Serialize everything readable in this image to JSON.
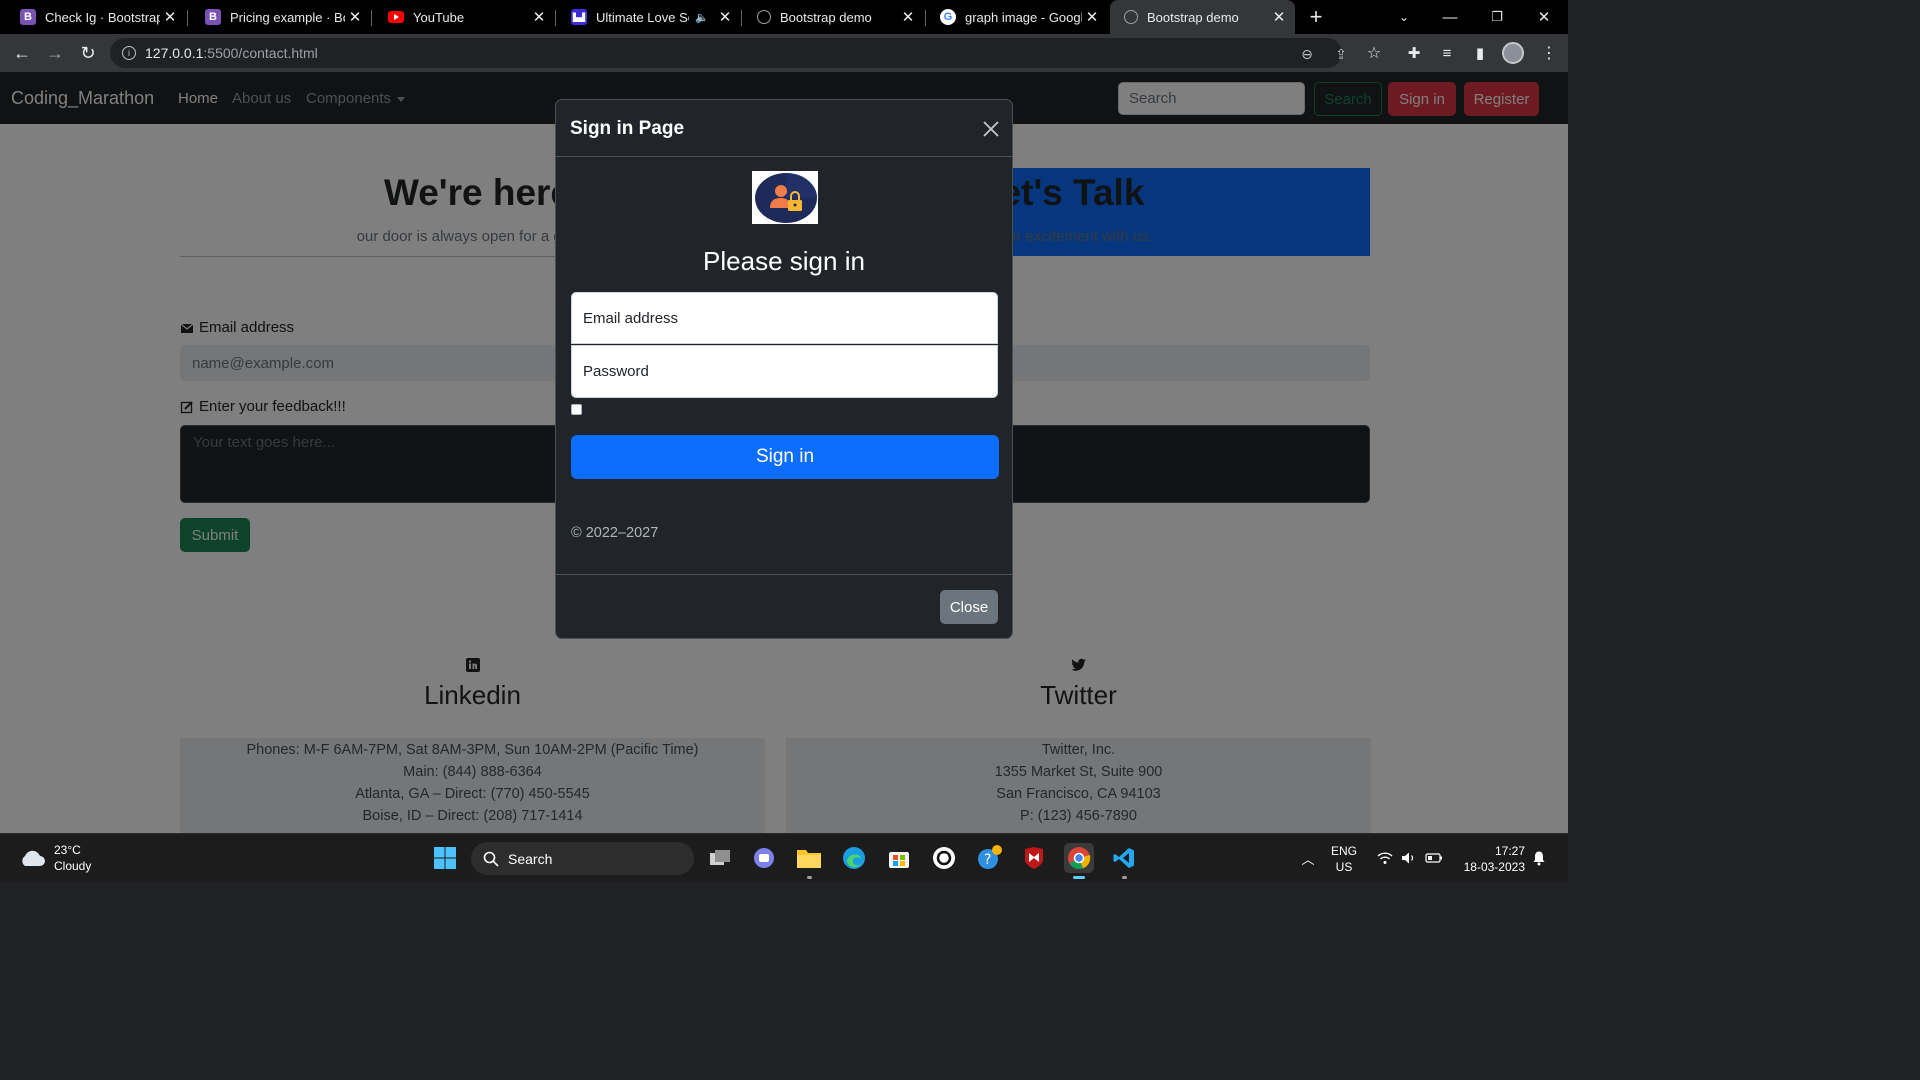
{
  "browser": {
    "tabs": [
      {
        "title": "Check Ig · Bootstrap Ic",
        "favicon": "bootstrap-icon",
        "color": "#7952b3"
      },
      {
        "title": "Pricing example · Boo",
        "favicon": "bootstrap-icon",
        "color": "#7952b3"
      },
      {
        "title": "YouTube",
        "favicon": "youtube-icon",
        "color": "#ff0000"
      },
      {
        "title": "Ultimate Love Son",
        "favicon": "music-icon",
        "color": "#3d2cd8",
        "audio": true
      },
      {
        "title": "Bootstrap demo",
        "favicon": "globe-icon",
        "color": "#9aa0a6"
      },
      {
        "title": "graph image - Googl",
        "favicon": "google-icon",
        "color": "#4285f4"
      },
      {
        "title": "Bootstrap demo",
        "favicon": "globe-icon",
        "color": "#9aa0a6",
        "active": true
      }
    ],
    "url_host": "127.0.0.1",
    "url_path": ":5500/contact.html"
  },
  "navbar": {
    "brand": "Coding_Marathon",
    "links": [
      "Home",
      "About us",
      "Components"
    ],
    "search_placeholder": "Search",
    "search_button": "Search",
    "signin_button": "Sign in",
    "register_button": "Register"
  },
  "hero": {
    "left_title": "We're here",
    "left_text": "our door is always open for a good c",
    "right_title": "et's Talk",
    "right_text": "your excitement with us."
  },
  "form": {
    "email_label": "Email address",
    "email_placeholder": "name@example.com",
    "feedback_label": "Enter your feedback!!!",
    "feedback_placeholder": "Your text goes here...",
    "submit": "Submit"
  },
  "social": {
    "linkedin_title": "Linkedin",
    "twitter_title": "Twitter",
    "linkedin_lines": [
      "Phones: M-F 6AM-7PM, Sat 8AM-3PM, Sun 10AM-2PM (Pacific Time)",
      "Main: (844) 888-6364",
      "Atlanta, GA – Direct: (770) 450-5545",
      "Boise, ID – Direct: (208) 717-1414"
    ],
    "twitter_lines": [
      "Twitter, Inc.",
      "1355 Market St, Suite 900",
      "San Francisco, CA 94103",
      "P: (123) 456-7890"
    ]
  },
  "modal": {
    "title": "Sign in Page",
    "heading": "Please sign in",
    "email_placeholder": "Email address",
    "password_placeholder": "Password",
    "signin_button": "Sign in",
    "copyright": "© 2022–2027",
    "close_button": "Close"
  },
  "taskbar": {
    "weather_temp": "23°C",
    "weather_desc": "Cloudy",
    "search_label": "Search",
    "lang_top": "ENG",
    "lang_bottom": "US",
    "time": "17:27",
    "date": "18-03-2023"
  }
}
